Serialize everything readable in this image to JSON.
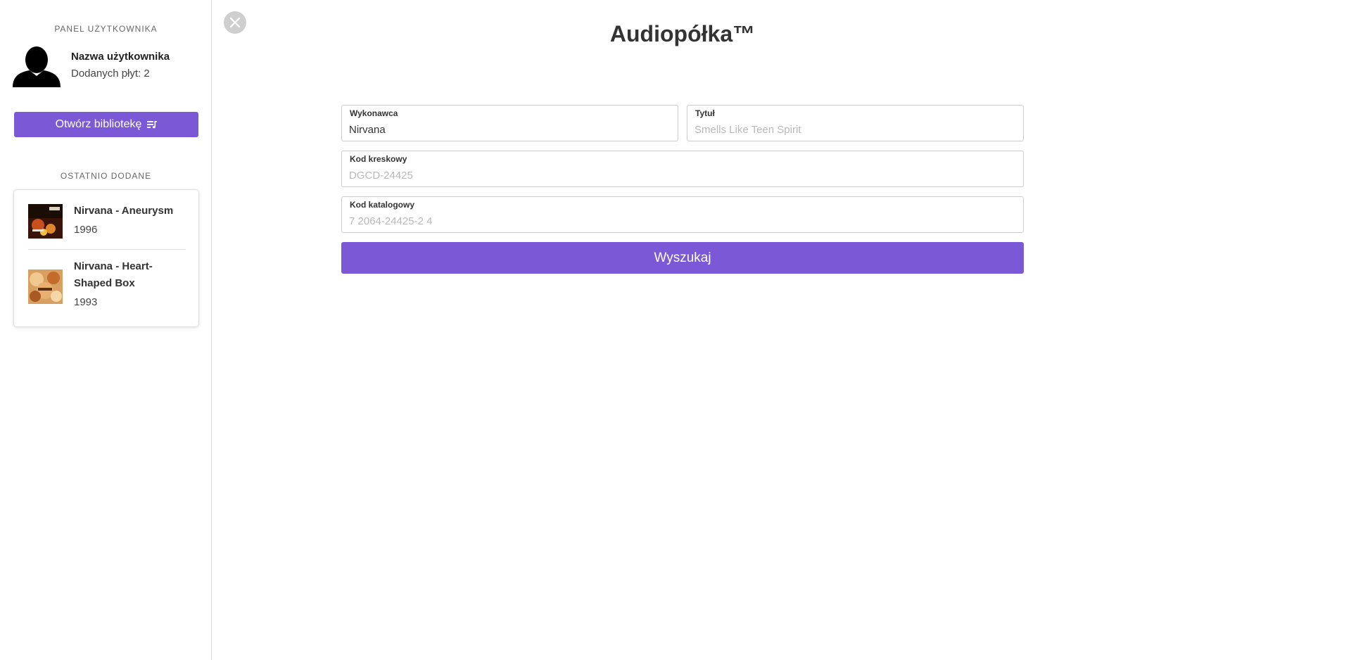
{
  "sidebar": {
    "panel_label": "PANEL UŻYTKOWNIKA",
    "user": {
      "name": "Nazwa użytkownika",
      "added_count": "Dodanych płyt: 2"
    },
    "library_button": {
      "label": "Otwórz bibliotekę",
      "icon": "playlist-icon"
    },
    "recent_label": "OSTATNIO DODANE",
    "recent": [
      {
        "title": "Nirvana - Aneurysm",
        "year": "1996"
      },
      {
        "title": "Nirvana - Heart-Shaped Box",
        "year": "1993"
      }
    ]
  },
  "close_icon": "close-icon",
  "main": {
    "title": "Audiopółka™",
    "fields": {
      "artist": {
        "label": "Wykonawca",
        "value": "Nirvana",
        "placeholder": ""
      },
      "title": {
        "label": "Tytuł",
        "value": "",
        "placeholder": "Smells Like Teen Spirit"
      },
      "barcode": {
        "label": "Kod kreskowy",
        "value": "",
        "placeholder": "DGCD-24425"
      },
      "catalog": {
        "label": "Kod katalogowy",
        "value": "",
        "placeholder": "7 2064-24425-2 4"
      }
    },
    "search_button": "Wyszukaj"
  },
  "colors": {
    "accent": "#7b58d6",
    "border": "#cccccc",
    "close_bg": "#cfcfcf"
  }
}
